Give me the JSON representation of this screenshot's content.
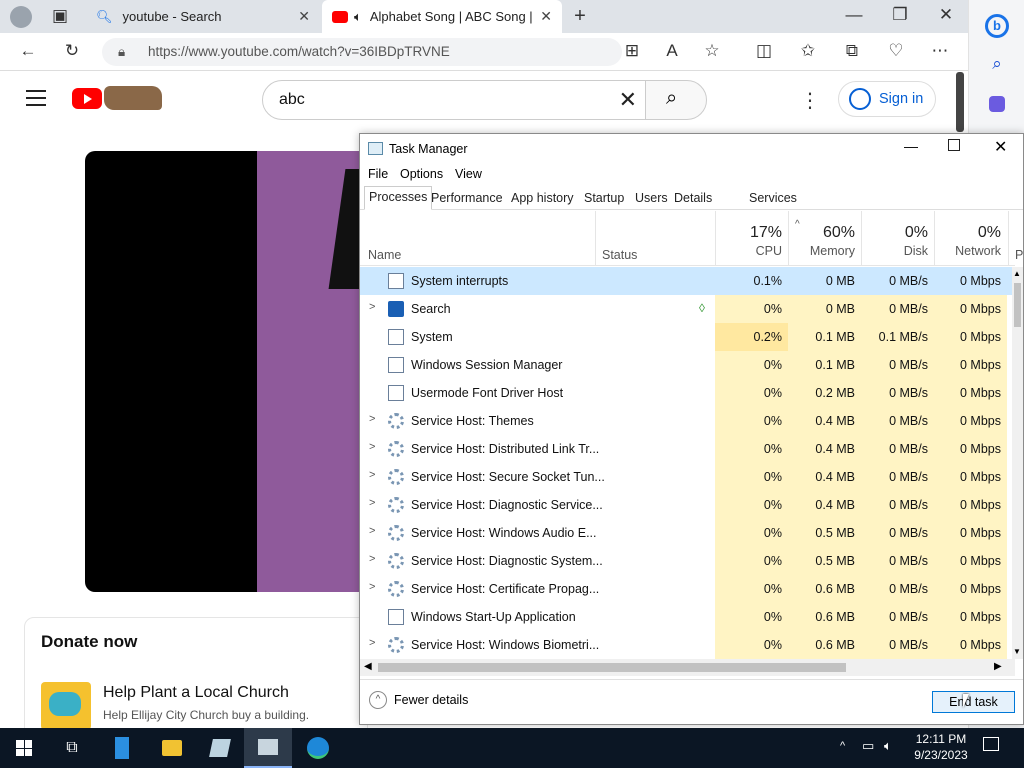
{
  "browser": {
    "tabs": [
      {
        "label": "youtube - Search"
      },
      {
        "label": "Alphabet Song | ABC Song |"
      }
    ],
    "url": "https://www.youtube.com/watch?v=36IBDpTRVNE"
  },
  "youtube": {
    "search_value": "abc",
    "signin_label": "Sign in",
    "donate_title": "Donate now",
    "donate_item_title": "Help Plant a Local Church",
    "donate_item_sub": "Help Ellijay City Church buy a building."
  },
  "task_manager": {
    "title": "Task Manager",
    "menu": [
      "File",
      "Options",
      "View"
    ],
    "tabs": [
      "Processes",
      "Performance",
      "App history",
      "Startup",
      "Users",
      "Details",
      "Services"
    ],
    "columns": {
      "name": "Name",
      "status": "Status",
      "cpu": {
        "pct": "17%",
        "label": "CPU"
      },
      "memory": {
        "pct": "60%",
        "label": "Memory"
      },
      "disk": {
        "pct": "0%",
        "label": "Disk"
      },
      "network": {
        "pct": "0%",
        "label": "Network"
      },
      "more": "P"
    },
    "rows": [
      {
        "name": "System interrupts",
        "cpu": "0.1%",
        "mem": "0 MB",
        "disk": "0 MB/s",
        "net": "0 Mbps",
        "expandable": false,
        "icon": "window-icon"
      },
      {
        "name": "Search",
        "cpu": "0%",
        "mem": "0 MB",
        "disk": "0 MB/s",
        "net": "0 Mbps",
        "expandable": true,
        "icon": "search-icon"
      },
      {
        "name": "System",
        "cpu": "0.2%",
        "mem": "0.1 MB",
        "disk": "0.1 MB/s",
        "net": "0 Mbps",
        "expandable": false,
        "icon": "window-icon"
      },
      {
        "name": "Windows Session Manager",
        "cpu": "0%",
        "mem": "0.1 MB",
        "disk": "0 MB/s",
        "net": "0 Mbps",
        "expandable": false,
        "icon": "window-icon"
      },
      {
        "name": "Usermode Font Driver Host",
        "cpu": "0%",
        "mem": "0.2 MB",
        "disk": "0 MB/s",
        "net": "0 Mbps",
        "expandable": false,
        "icon": "window-icon"
      },
      {
        "name": "Service Host: Themes",
        "cpu": "0%",
        "mem": "0.4 MB",
        "disk": "0 MB/s",
        "net": "0 Mbps",
        "expandable": true,
        "icon": "gear-icon"
      },
      {
        "name": "Service Host: Distributed Link Tr...",
        "cpu": "0%",
        "mem": "0.4 MB",
        "disk": "0 MB/s",
        "net": "0 Mbps",
        "expandable": true,
        "icon": "gear-icon"
      },
      {
        "name": "Service Host: Secure Socket Tun...",
        "cpu": "0%",
        "mem": "0.4 MB",
        "disk": "0 MB/s",
        "net": "0 Mbps",
        "expandable": true,
        "icon": "gear-icon"
      },
      {
        "name": "Service Host: Diagnostic Service...",
        "cpu": "0%",
        "mem": "0.4 MB",
        "disk": "0 MB/s",
        "net": "0 Mbps",
        "expandable": true,
        "icon": "gear-icon"
      },
      {
        "name": "Service Host: Windows Audio E...",
        "cpu": "0%",
        "mem": "0.5 MB",
        "disk": "0 MB/s",
        "net": "0 Mbps",
        "expandable": true,
        "icon": "gear-icon"
      },
      {
        "name": "Service Host: Diagnostic System...",
        "cpu": "0%",
        "mem": "0.5 MB",
        "disk": "0 MB/s",
        "net": "0 Mbps",
        "expandable": true,
        "icon": "gear-icon"
      },
      {
        "name": "Service Host: Certificate Propag...",
        "cpu": "0%",
        "mem": "0.6 MB",
        "disk": "0 MB/s",
        "net": "0 Mbps",
        "expandable": true,
        "icon": "gear-icon"
      },
      {
        "name": "Windows Start-Up Application",
        "cpu": "0%",
        "mem": "0.6 MB",
        "disk": "0 MB/s",
        "net": "0 Mbps",
        "expandable": false,
        "icon": "window-icon"
      },
      {
        "name": "Service Host: Windows Biometri...",
        "cpu": "0%",
        "mem": "0.6 MB",
        "disk": "0 MB/s",
        "net": "0 Mbps",
        "expandable": true,
        "icon": "gear-icon"
      }
    ],
    "fewer_details": "Fewer details",
    "end_task": "End task"
  },
  "taskbar": {
    "time": "12:11 PM",
    "date": "9/23/2023"
  },
  "colors": {
    "selected_row": "#cce8ff",
    "heat_cell": "#fff4c4",
    "accent": "#0078d7"
  }
}
